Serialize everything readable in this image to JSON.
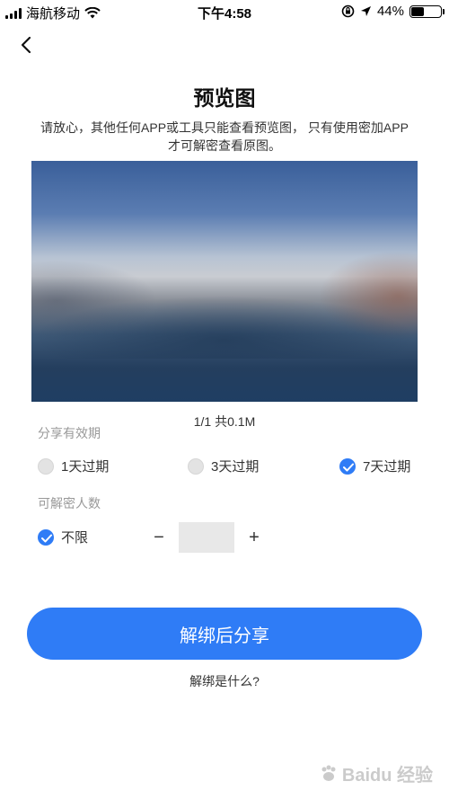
{
  "status_bar": {
    "carrier": "海航移动",
    "time": "下午4:58",
    "battery": "44%",
    "battery_level": 0.44
  },
  "header": {
    "back_icon": "chevron-left-icon"
  },
  "title": "预览图",
  "description": "请放心，其他任何APP或工具只能查看预览图， 只有使用密加APP才可解密查看原图。",
  "preview": {
    "page_info": "1/1 共0.1M"
  },
  "expiry": {
    "label": "分享有效期",
    "options": [
      {
        "label": "1天过期",
        "selected": false
      },
      {
        "label": "3天过期",
        "selected": false
      },
      {
        "label": "7天过期",
        "selected": true
      }
    ]
  },
  "decrypt_count": {
    "label": "可解密人数",
    "unlimited_label": "不限",
    "unlimited_selected": true,
    "minus": "−",
    "plus": "+",
    "value": ""
  },
  "share_button": "解绑后分享",
  "what_is_link": "解绑是什么?",
  "watermark": "Baidu 经验",
  "colors": {
    "accent": "#2f7cf6"
  }
}
